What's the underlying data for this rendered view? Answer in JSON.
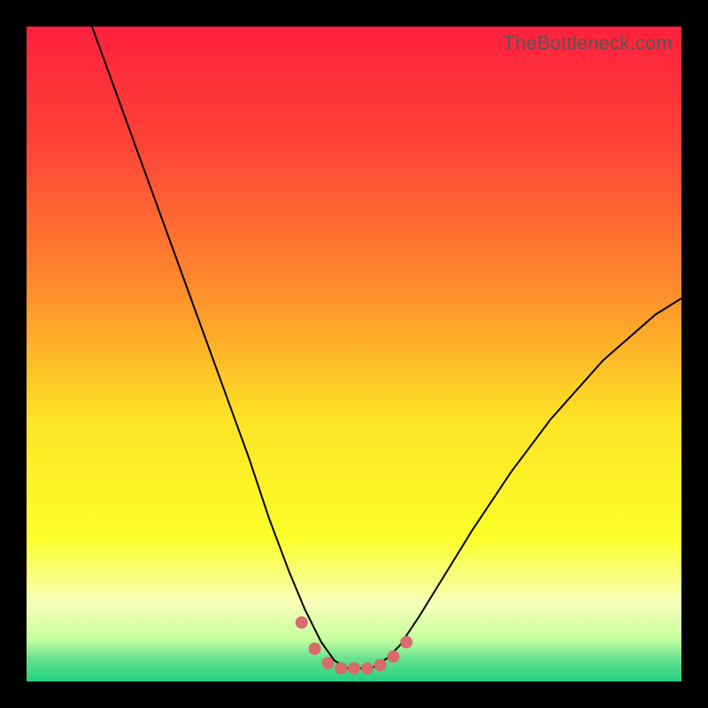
{
  "watermark": "TheBottleneck.com",
  "chart_data": {
    "type": "line",
    "title": "",
    "xlabel": "",
    "ylabel": "",
    "xlim": [
      0,
      100
    ],
    "ylim": [
      0,
      100
    ],
    "background_gradient": {
      "stops": [
        {
          "pos": 0.0,
          "color": "#ff203d"
        },
        {
          "pos": 0.18,
          "color": "#ff4337"
        },
        {
          "pos": 0.4,
          "color": "#fe8c2c"
        },
        {
          "pos": 0.6,
          "color": "#fde325"
        },
        {
          "pos": 0.78,
          "color": "#fbff28"
        },
        {
          "pos": 0.88,
          "color": "#f6ffba"
        },
        {
          "pos": 0.935,
          "color": "#c7ff9e"
        },
        {
          "pos": 0.965,
          "color": "#66e28f"
        },
        {
          "pos": 1.0,
          "color": "#21d281"
        }
      ]
    },
    "series": [
      {
        "name": "bottleneck-curve",
        "color": "#000000",
        "width": 2,
        "x": [
          10.0,
          14.0,
          18.0,
          22.0,
          26.0,
          30.0,
          34.0,
          37.0,
          40.0,
          42.5,
          45.0,
          47.0,
          49.0,
          51.0,
          53.0,
          55.0,
          57.0,
          60.0,
          64.0,
          68.0,
          74.0,
          80.0,
          88.0,
          96.0,
          100.0
        ],
        "y": [
          100.0,
          89.0,
          78.0,
          67.0,
          56.0,
          45.0,
          34.0,
          25.0,
          17.0,
          11.0,
          6.0,
          3.2,
          2.0,
          2.0,
          2.2,
          3.5,
          5.5,
          10.0,
          16.5,
          23.0,
          32.0,
          40.0,
          49.0,
          56.0,
          58.5
        ]
      },
      {
        "name": "highlight-dots",
        "color": "#d86b6b",
        "type": "scatter",
        "marker_size": 14,
        "x": [
          42.0,
          44.0,
          46.0,
          48.0,
          50.0,
          52.0,
          54.0,
          56.0,
          58.0
        ],
        "y": [
          9.0,
          5.0,
          2.8,
          2.0,
          2.0,
          2.0,
          2.5,
          3.8,
          6.0
        ]
      }
    ]
  }
}
